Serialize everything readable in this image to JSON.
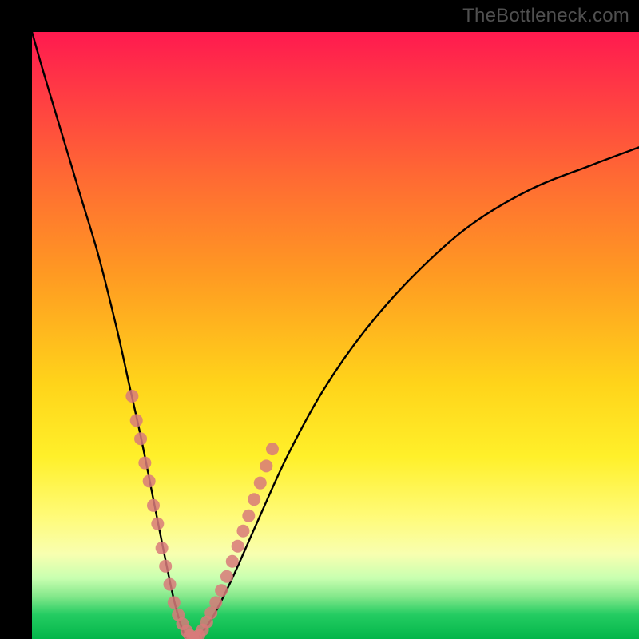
{
  "watermark": "TheBottleneck.com",
  "chart_data": {
    "type": "line",
    "title": "",
    "xlabel": "",
    "ylabel": "",
    "xlim": [
      0,
      100
    ],
    "ylim": [
      0,
      100
    ],
    "note": "V-shaped bottleneck curve; y represents mismatch/penalty decreasing to 0 at optimum then rising again",
    "series": [
      {
        "name": "bottleneck-curve",
        "x": [
          0,
          2,
          5,
          8,
          11,
          14,
          16,
          18,
          20,
          22,
          23.5,
          25,
          26,
          27,
          28,
          30,
          33,
          37,
          42,
          48,
          55,
          63,
          72,
          82,
          92,
          100
        ],
        "values": [
          100,
          93,
          83,
          73,
          63,
          51,
          42,
          33,
          23,
          13,
          6,
          1,
          0,
          0,
          1,
          4,
          10,
          19,
          30,
          41,
          51,
          60,
          68,
          74,
          78,
          81
        ]
      }
    ],
    "markers": {
      "name": "sample-points",
      "color": "#d87a7a",
      "points": [
        {
          "x": 16.5,
          "y": 40
        },
        {
          "x": 17.2,
          "y": 36
        },
        {
          "x": 17.9,
          "y": 33
        },
        {
          "x": 18.6,
          "y": 29
        },
        {
          "x": 19.3,
          "y": 26
        },
        {
          "x": 20.0,
          "y": 22
        },
        {
          "x": 20.7,
          "y": 19
        },
        {
          "x": 21.4,
          "y": 15
        },
        {
          "x": 22.0,
          "y": 12
        },
        {
          "x": 22.7,
          "y": 9
        },
        {
          "x": 23.4,
          "y": 6
        },
        {
          "x": 24.1,
          "y": 4
        },
        {
          "x": 24.8,
          "y": 2.5
        },
        {
          "x": 25.5,
          "y": 1.3
        },
        {
          "x": 26.0,
          "y": 0.6
        },
        {
          "x": 26.5,
          "y": 0.2
        },
        {
          "x": 27.0,
          "y": 0.2
        },
        {
          "x": 27.5,
          "y": 0.6
        },
        {
          "x": 28.1,
          "y": 1.5
        },
        {
          "x": 28.8,
          "y": 2.8
        },
        {
          "x": 29.5,
          "y": 4.3
        },
        {
          "x": 30.3,
          "y": 6.0
        },
        {
          "x": 31.2,
          "y": 8.0
        },
        {
          "x": 32.1,
          "y": 10.3
        },
        {
          "x": 33.0,
          "y": 12.8
        },
        {
          "x": 33.9,
          "y": 15.3
        },
        {
          "x": 34.8,
          "y": 17.8
        },
        {
          "x": 35.7,
          "y": 20.3
        },
        {
          "x": 36.6,
          "y": 23.0
        },
        {
          "x": 37.6,
          "y": 25.7
        },
        {
          "x": 38.6,
          "y": 28.5
        },
        {
          "x": 39.6,
          "y": 31.3
        }
      ]
    }
  }
}
